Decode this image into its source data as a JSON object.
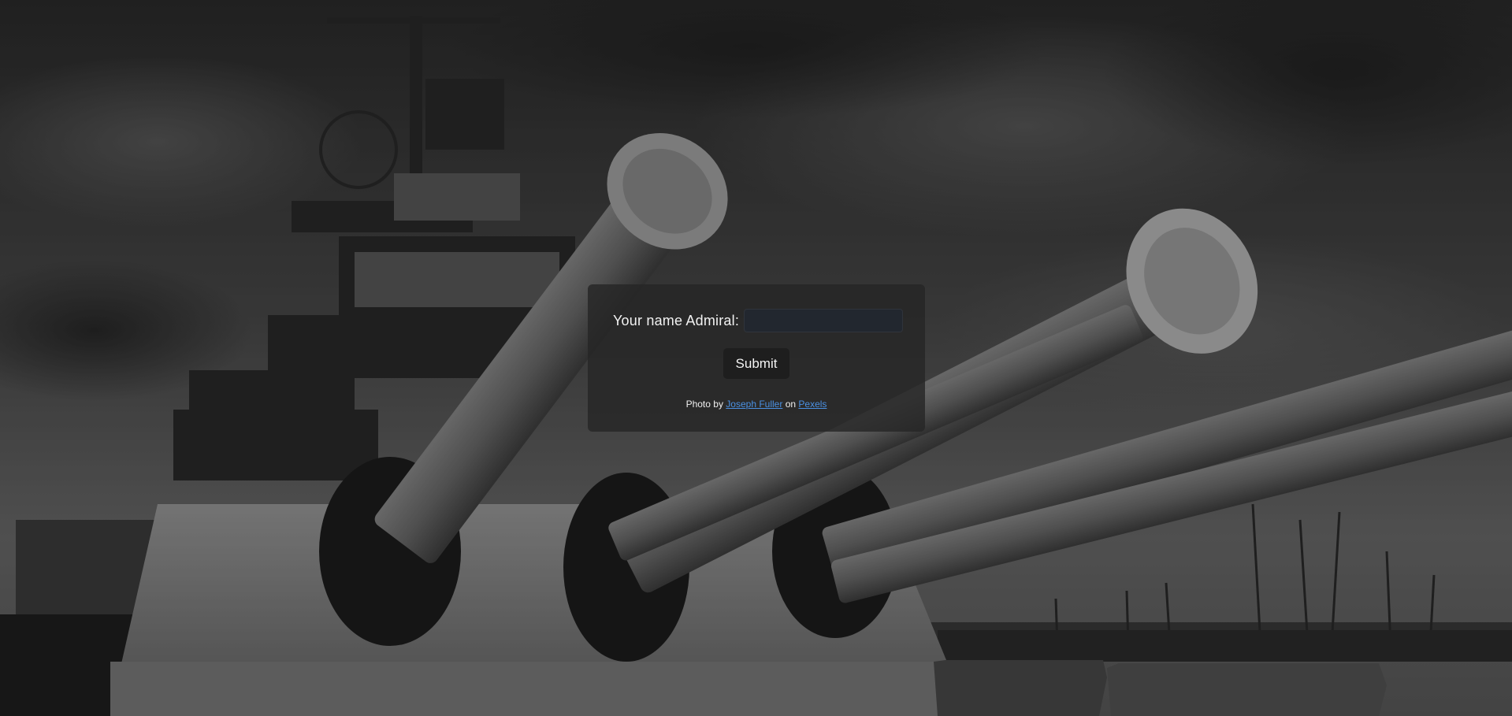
{
  "background": {
    "description_icon": "battleship-guns-photo"
  },
  "form": {
    "name_label": "Your name Admiral:",
    "name_value": "",
    "name_placeholder": "",
    "submit_label": "Submit"
  },
  "credit": {
    "prefix": "Photo by",
    "author": "Joseph Fuller",
    "middle": "on",
    "site": "Pexels"
  },
  "colors": {
    "panel": "#262626",
    "link": "#4a90e2",
    "input": "#22272f"
  }
}
